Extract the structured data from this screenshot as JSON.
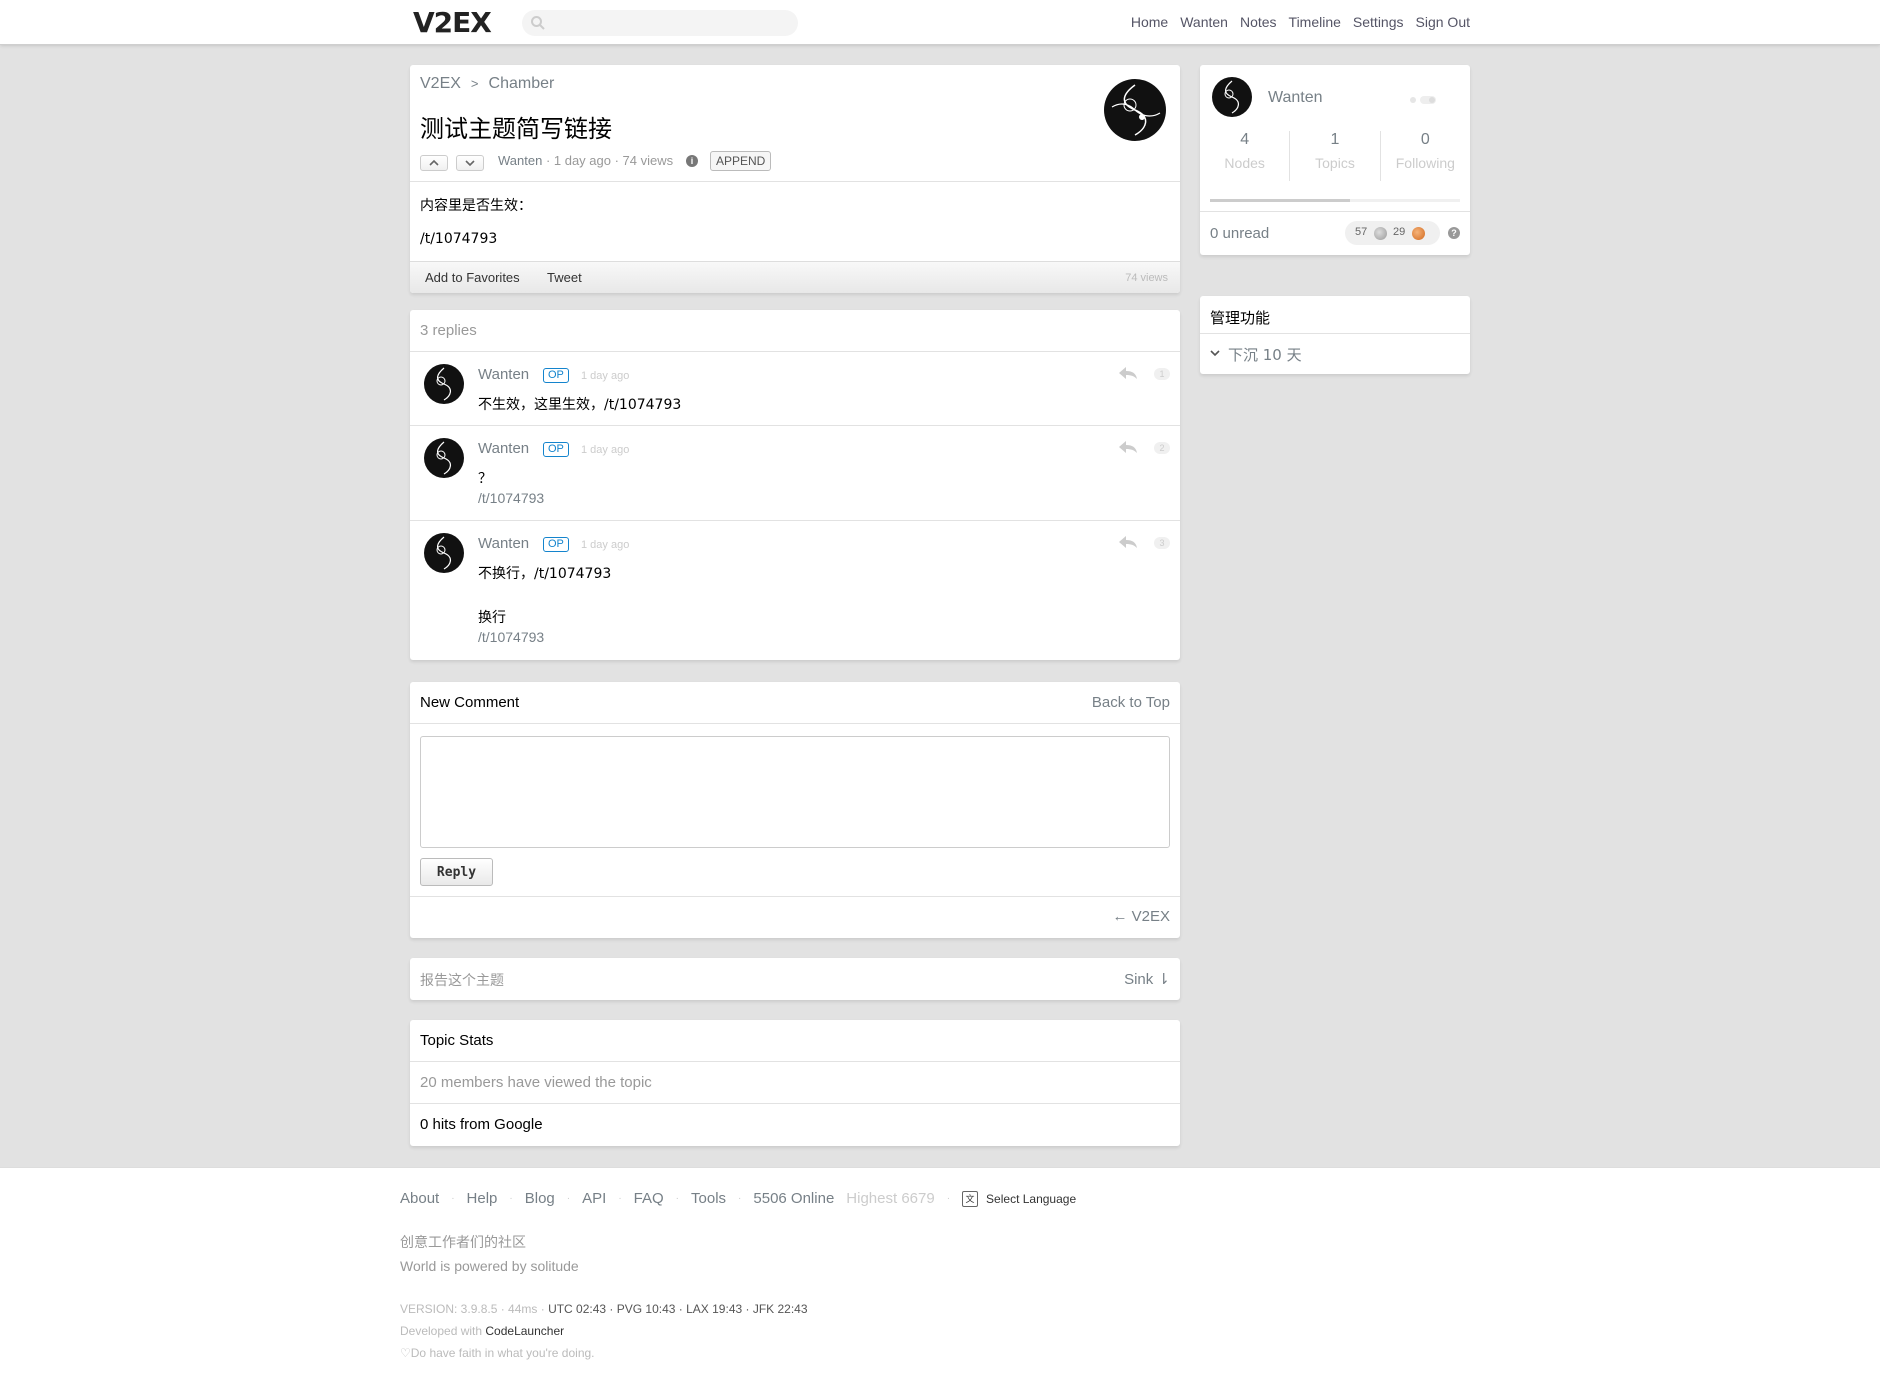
{
  "header": {
    "logo": "V2EX",
    "nav": [
      "Home",
      "Wanten",
      "Notes",
      "Timeline",
      "Settings",
      "Sign Out"
    ]
  },
  "topic": {
    "breadcrumb_root": "V2EX",
    "breadcrumb_sep": ">",
    "breadcrumb_node": "Chamber",
    "title": "测试主题简写链接",
    "meta_author": "Wanten",
    "meta_rest": " · 1 day ago · 74 views",
    "append_label": "APPEND",
    "content_line1": "内容里是否生效：",
    "content_line2": "/t/1074793",
    "favorite_label": "Add to Favorites",
    "tweet_label": "Tweet",
    "views_label": "74 views"
  },
  "replies": {
    "count_label": "3 replies",
    "items": [
      {
        "author": "Wanten",
        "badge": "OP",
        "time": "1 day ago",
        "floor": "1",
        "text1": "不生效，这里生效，/t/1074793",
        "text2": ""
      },
      {
        "author": "Wanten",
        "badge": "OP",
        "time": "1 day ago",
        "floor": "2",
        "text1": "？",
        "text2": "/t/1074793"
      },
      {
        "author": "Wanten",
        "badge": "OP",
        "time": "1 day ago",
        "floor": "3",
        "text1": "不换行，/t/1074793",
        "text2": "换行",
        "text3": "/t/1074793"
      }
    ]
  },
  "comment": {
    "title": "New Comment",
    "back_to_top": "Back to Top",
    "reply_button": "Reply",
    "back_link": "← V2EX"
  },
  "report": {
    "label": "报告这个主题",
    "sink": "Sink ⇂"
  },
  "topic_stats": {
    "title": "Topic Stats",
    "viewed": "20 members have viewed the topic",
    "google": "0 hits from Google"
  },
  "sidebar": {
    "username": "Wanten",
    "stats": [
      {
        "num": "4",
        "label": "Nodes"
      },
      {
        "num": "1",
        "label": "Topics"
      },
      {
        "num": "0",
        "label": "Following"
      }
    ],
    "progress_fraction": 0.56,
    "unread": "0 unread",
    "silver": "57",
    "bronze": "29",
    "admin_title": "管理功能",
    "admin_item": "下沉 10 天"
  },
  "footer": {
    "links": [
      "About",
      "Help",
      "Blog",
      "API",
      "FAQ",
      "Tools"
    ],
    "online": "5506 Online",
    "highest": "Highest 6679",
    "language": "Select Language",
    "slogan1": "创意工作者们的社区",
    "slogan2": "World is powered by solitude",
    "version": "VERSION: 3.9.8.5 · 44ms · ",
    "times": "UTC 02:43 · PVG 10:43 · LAX 19:43 · JFK 22:43",
    "dev_prefix": "Developed with ",
    "dev_name": "CodeLauncher",
    "faith": "Do have faith in what you're doing."
  },
  "colors": {
    "link": "#778087",
    "op_badge": "#1484cd",
    "background": "#e2e2e2"
  }
}
